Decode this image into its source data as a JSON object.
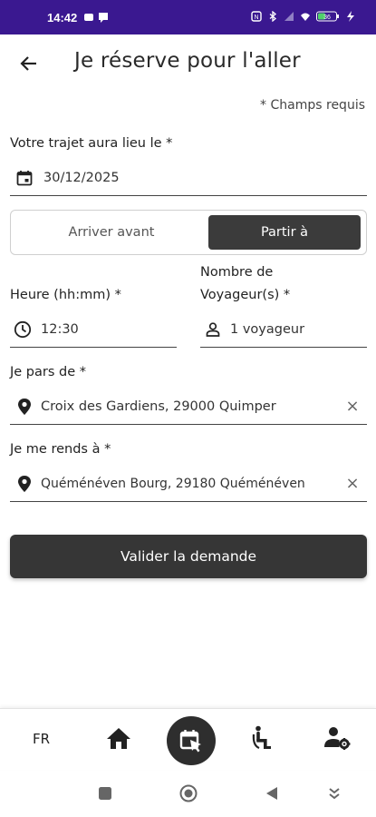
{
  "status_bar": {
    "time": "14:42",
    "battery": "36"
  },
  "header": {
    "title": "Je réserve pour l'aller"
  },
  "required_note": "* Champs requis",
  "date_field": {
    "label": "Votre trajet aura lieu le *",
    "value": "30/12/2025"
  },
  "mode_toggle": {
    "option_arrive": "Arriver avant",
    "option_depart": "Partir à",
    "selected": "Partir à"
  },
  "time_field": {
    "label": "Heure (hh:mm) *",
    "value": "12:30"
  },
  "travelers_field": {
    "label_line1": "Nombre de",
    "label_line2": "Voyageur(s) *",
    "value": "1 voyageur"
  },
  "from_field": {
    "label": "Je pars de *",
    "value": "Croix des Gardiens, 29000 Quimper"
  },
  "to_field": {
    "label": "Je me rends à *",
    "value": "Quéménéven Bourg, 29180 Quéménéven"
  },
  "submit": {
    "label": "Valider la demande"
  },
  "bottom_nav": {
    "language": "FR",
    "items": [
      "home-icon",
      "booking-icon",
      "accessibility-icon",
      "user-settings-icon"
    ],
    "active": "booking-icon"
  },
  "colors": {
    "status_bar": "#3a1890",
    "primary_dark": "#363636"
  }
}
